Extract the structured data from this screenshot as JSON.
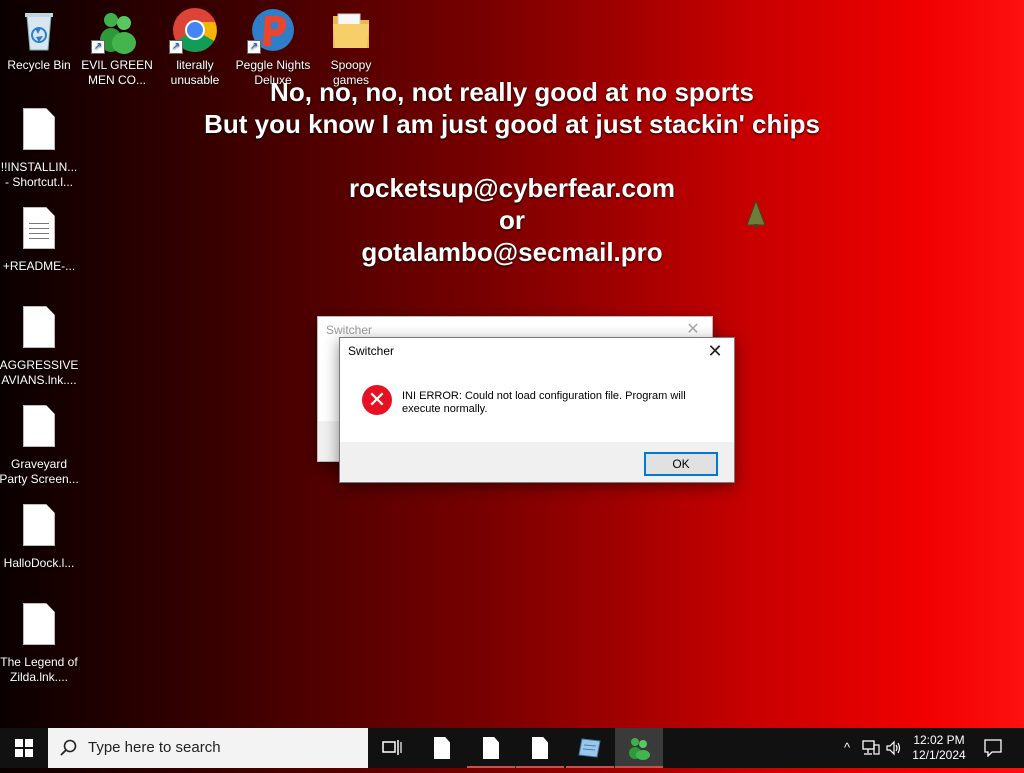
{
  "desktop": {
    "top_icons": [
      {
        "label": "Recycle Bin",
        "icon": "recycle-bin-icon"
      },
      {
        "label": "EVIL GREEN MEN CO...",
        "icon": "green-men-icon"
      },
      {
        "label": "literally unusable",
        "icon": "chrome-icon"
      },
      {
        "label": "Peggle Nights Deluxe",
        "icon": "peggle-icon"
      },
      {
        "label": "Spoopy games",
        "icon": "folder-icon"
      }
    ],
    "left_icons": [
      {
        "label": "!!INSTALLIN... - Shortcut.l...",
        "icon": "document-icon"
      },
      {
        "label": "+README-...",
        "icon": "text-document-icon"
      },
      {
        "label": "AGGRESSIVE AVIANS.lnk....",
        "icon": "document-icon"
      },
      {
        "label": "Graveyard Party Screen...",
        "icon": "document-icon"
      },
      {
        "label": "HalloDock.l...",
        "icon": "document-icon"
      },
      {
        "label": "The Legend of Zilda.lnk....",
        "icon": "document-icon"
      }
    ]
  },
  "ransom_note": {
    "line1": "No, no, no, not really good at no sports",
    "line2": "But you know I am just good at just stackin' chips",
    "email1": "rocketsup@cyberfear.com",
    "or": "or",
    "email2": "gotalambo@secmail.pro"
  },
  "back_dialog": {
    "title": "Switcher",
    "close": "✕"
  },
  "dialog": {
    "title": "Switcher",
    "close": "✕",
    "message": "INI ERROR: Could not load configuration file. Program will execute normally.",
    "ok": "OK",
    "icon": "error-icon",
    "icon_color": "#e81123"
  },
  "taskbar": {
    "search_placeholder": "Type here to search",
    "pinned": [
      "task-view-icon",
      "file-icon",
      "file-icon",
      "file-icon",
      "notepad-icon",
      "green-men-icon"
    ],
    "time": "12:02 PM",
    "date": "12/1/2024",
    "accent": "#0078d7"
  }
}
